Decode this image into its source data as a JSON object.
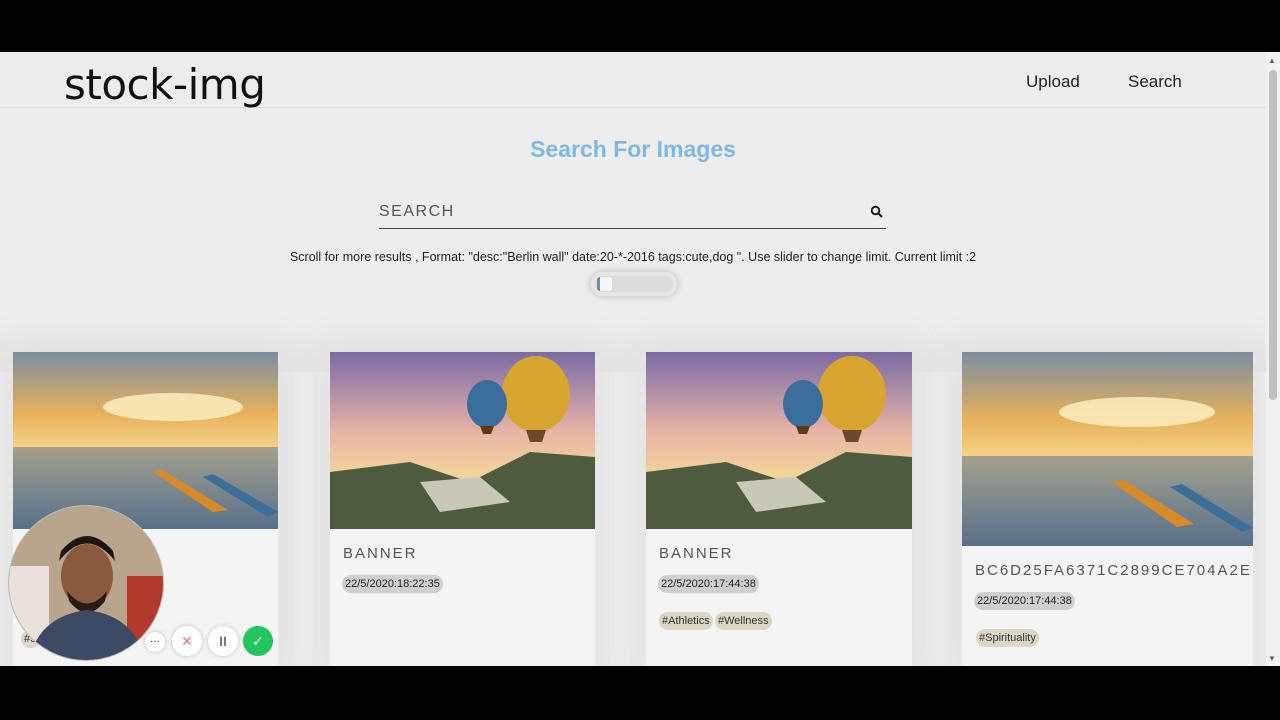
{
  "header": {
    "logo": "stock-img",
    "nav": {
      "upload": "Upload",
      "search": "Search"
    }
  },
  "main": {
    "title": "Search For Images",
    "search_placeholder": "SEARCH",
    "hint": "Scroll for more results , Format: \"desc:\"Berlin wall\" date:20-*-2016 tags:cute,dog \". Use slider to change limit. Current limit :2"
  },
  "cards": [
    {
      "image": "kayak-lake-sunset",
      "title": "",
      "date": "",
      "tags": [
        "#S"
      ]
    },
    {
      "image": "hot-air-balloons",
      "title": "BANNER",
      "date": "22/5/2020:18:22:35",
      "tags": []
    },
    {
      "image": "hot-air-balloons",
      "title": "BANNER",
      "date": "22/5/2020:17:44:38",
      "tags": [
        "#Athletics",
        "#Wellness"
      ]
    },
    {
      "image": "kayak-lake-sunset",
      "title": "BC6D25FA6371C2899CE704A2E",
      "date": "22/5/2020:17:44:38",
      "tags": [
        "#Spirituality"
      ]
    }
  ],
  "recorder": {
    "more_label": "···",
    "cancel_label": "✕",
    "pause_label": "II",
    "confirm_label": "✓"
  },
  "colors": {
    "title": "#7fb8e2",
    "tag_bg": "#dcd6c6",
    "date_bg": "#cfcfcf",
    "confirm": "#22c55e"
  }
}
